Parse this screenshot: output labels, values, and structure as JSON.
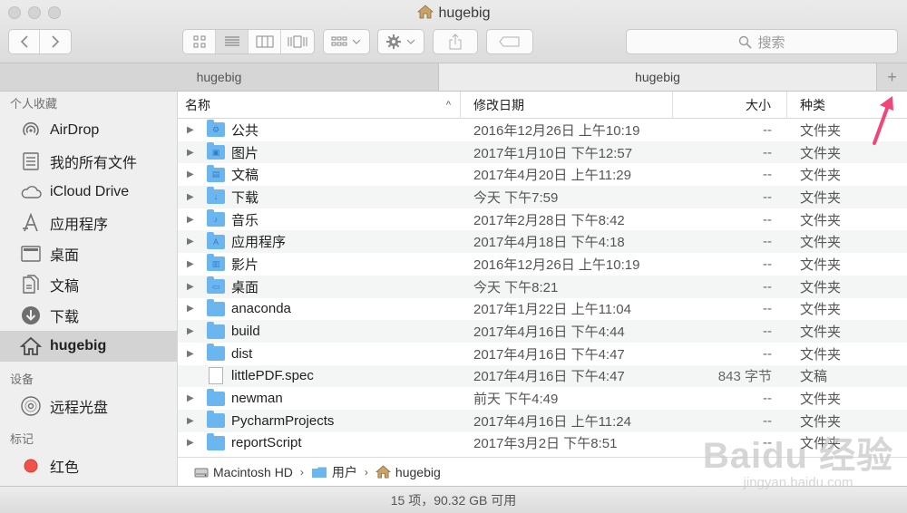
{
  "window": {
    "title": "hugebig"
  },
  "search": {
    "placeholder": "搜索"
  },
  "tabs": [
    {
      "label": "hugebig"
    },
    {
      "label": "hugebig"
    }
  ],
  "tab_add": "+",
  "sidebar": {
    "sections": [
      {
        "title": "个人收藏",
        "items": [
          {
            "label": "AirDrop",
            "icon": "airdrop-icon"
          },
          {
            "label": "我的所有文件",
            "icon": "all-files-icon"
          },
          {
            "label": "iCloud Drive",
            "icon": "cloud-icon"
          },
          {
            "label": "应用程序",
            "icon": "applications-icon"
          },
          {
            "label": "桌面",
            "icon": "desktop-icon"
          },
          {
            "label": "文稿",
            "icon": "documents-icon"
          },
          {
            "label": "下载",
            "icon": "download-icon"
          },
          {
            "label": "hugebig",
            "icon": "home-icon",
            "selected": true
          }
        ]
      },
      {
        "title": "设备",
        "items": [
          {
            "label": "远程光盘",
            "icon": "disc-icon"
          }
        ]
      },
      {
        "title": "标记",
        "items": [
          {
            "label": "红色",
            "icon": "red-tag-icon",
            "color": "#f0524a"
          }
        ]
      }
    ]
  },
  "list": {
    "columns": {
      "name": "名称",
      "date": "修改日期",
      "size": "大小",
      "kind": "种类"
    },
    "sort_indicator": "^",
    "rows": [
      {
        "name": "公共",
        "date": "2016年12月26日 上午10:19",
        "size": "--",
        "kind": "文件夹",
        "type": "folder",
        "glyph": "⚙"
      },
      {
        "name": "图片",
        "date": "2017年1月10日 下午12:57",
        "size": "--",
        "kind": "文件夹",
        "type": "folder",
        "glyph": "▣"
      },
      {
        "name": "文稿",
        "date": "2017年4月20日 上午11:29",
        "size": "--",
        "kind": "文件夹",
        "type": "folder",
        "glyph": "▤"
      },
      {
        "name": "下载",
        "date": "今天 下午7:59",
        "size": "--",
        "kind": "文件夹",
        "type": "folder",
        "glyph": "↓"
      },
      {
        "name": "音乐",
        "date": "2017年2月28日 下午8:42",
        "size": "--",
        "kind": "文件夹",
        "type": "folder",
        "glyph": "♪"
      },
      {
        "name": "应用程序",
        "date": "2017年4月18日 下午4:18",
        "size": "--",
        "kind": "文件夹",
        "type": "folder",
        "glyph": "A"
      },
      {
        "name": "影片",
        "date": "2016年12月26日 上午10:19",
        "size": "--",
        "kind": "文件夹",
        "type": "folder",
        "glyph": "▥"
      },
      {
        "name": "桌面",
        "date": "今天 下午8:21",
        "size": "--",
        "kind": "文件夹",
        "type": "folder",
        "glyph": "▭"
      },
      {
        "name": "anaconda",
        "date": "2017年1月22日 上午11:04",
        "size": "--",
        "kind": "文件夹",
        "type": "folder",
        "glyph": ""
      },
      {
        "name": "build",
        "date": "2017年4月16日 下午4:44",
        "size": "--",
        "kind": "文件夹",
        "type": "folder",
        "glyph": ""
      },
      {
        "name": "dist",
        "date": "2017年4月16日 下午4:47",
        "size": "--",
        "kind": "文件夹",
        "type": "folder",
        "glyph": ""
      },
      {
        "name": "littlePDF.spec",
        "date": "2017年4月16日 下午4:47",
        "size": "843 字节",
        "kind": "文稿",
        "type": "doc",
        "glyph": ""
      },
      {
        "name": "newman",
        "date": "前天 下午4:49",
        "size": "--",
        "kind": "文件夹",
        "type": "folder",
        "glyph": ""
      },
      {
        "name": "PycharmProjects",
        "date": "2017年4月16日 上午11:24",
        "size": "--",
        "kind": "文件夹",
        "type": "folder",
        "glyph": ""
      },
      {
        "name": "reportScript",
        "date": "2017年3月2日 下午8:51",
        "size": "--",
        "kind": "文件夹",
        "type": "folder",
        "glyph": ""
      }
    ]
  },
  "pathbar": [
    {
      "label": "Macintosh HD",
      "icon": "hard-drive-icon"
    },
    {
      "label": "用户",
      "icon": "folder-icon"
    },
    {
      "label": "hugebig",
      "icon": "home-icon"
    }
  ],
  "pathbar_sep": "›",
  "status": {
    "text": "15 项，90.32 GB 可用"
  },
  "watermark": {
    "line1": "Baidu 经验",
    "line2": "jingyan.baidu.com"
  },
  "colors": {
    "folder": "#6bb6ee",
    "annotation_arrow": "#f2457a",
    "selection": "#d3d3d3"
  }
}
